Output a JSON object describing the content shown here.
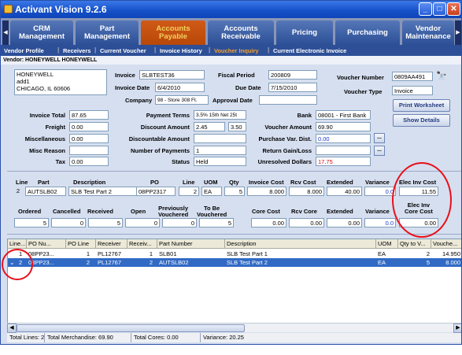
{
  "window": {
    "title": "Activant Vision 9.2.6"
  },
  "tabs": [
    {
      "label": "CRM\nManagement"
    },
    {
      "label": "Part\nManagement"
    },
    {
      "label": "Accounts\nPayable"
    },
    {
      "label": "Accounts\nReceivable"
    },
    {
      "label": "Pricing"
    },
    {
      "label": "Purchasing"
    },
    {
      "label": "Vendor\nMaintenance"
    }
  ],
  "subnav": [
    {
      "label": "Vendor Profile"
    },
    {
      "label": "Receivers"
    },
    {
      "label": "Current Voucher"
    },
    {
      "label": "Invoice History"
    },
    {
      "label": "Voucher Inquiry"
    },
    {
      "label": "Current Electronic Invoice"
    }
  ],
  "vendor_bar": "Vendor: HONEYWELL HONEYWELL",
  "address": [
    "HONEYWELL",
    "add1",
    "CHICAGO, IL 60606"
  ],
  "header": {
    "invoice_label": "Invoice",
    "invoice": "SLBTEST36",
    "invoice_date_label": "Invoice Date",
    "invoice_date": "6/4/2010",
    "company_label": "Company",
    "company": "98 - Store 308 Ft.",
    "fiscal_period_label": "Fiscal Period",
    "fiscal_period": "200809",
    "due_date_label": "Due Date",
    "due_date": "7/15/2010",
    "approval_date_label": "Approval Date",
    "approval_date": "",
    "voucher_number_label": "Voucher Number",
    "voucher_number": "0809AA491",
    "voucher_type_label": "Voucher Type",
    "voucher_type": "Invoice"
  },
  "buttons": {
    "print_worksheet": "Print Worksheet",
    "show_details": "Show Details",
    "ellipsis": "..."
  },
  "totals": {
    "invoice_total_label": "Invoice Total",
    "invoice_total": "87.65",
    "freight_label": "Freight",
    "freight": "0.00",
    "miscellaneous_label": "Miscellaneous",
    "miscellaneous": "0.00",
    "misc_reason_label": "Misc Reason",
    "misc_reason": "",
    "tax_label": "Tax",
    "tax": "0.00",
    "payment_terms_label": "Payment Terms",
    "payment_terms": "3.5% 15th Net 25t",
    "discount_amount_label": "Discount Amount",
    "discount_amount": "2.45",
    "discount_pct": "3.50",
    "discountable_amount_label": "Discountable Amount",
    "discountable_amount": "",
    "num_payments_label": "Number of Payments",
    "num_payments": "1",
    "status_label": "Status",
    "status": "Held",
    "bank_label": "Bank",
    "bank": "08001 - First Bank",
    "voucher_amount_label": "Voucher Amount",
    "voucher_amount": "69.90",
    "purchase_var_label": "Purchase Var. Dist.",
    "purchase_var": "0.00",
    "return_gain_label": "Return Gain/Loss",
    "return_gain": "",
    "unresolved_label": "Unresolved Dollars",
    "unresolved": "17.75"
  },
  "line_detail": {
    "headers": [
      "Line",
      "Part",
      "Description",
      "PO",
      "Line",
      "UOM",
      "Qty",
      "Invoice Cost",
      "Rcv Cost",
      "Extended",
      "Variance",
      "Elec Inv Cost"
    ],
    "values": [
      "2",
      "AUTSLB02",
      "SLB Test Part 2",
      "08PP2317",
      "2",
      "EA",
      "5",
      "8.000",
      "8.000",
      "40.00",
      "0.0",
      "11.55"
    ],
    "headers2": [
      "Ordered",
      "Cancelled",
      "Received",
      "Open",
      "Previously\nVouchered",
      "To Be\nVouchered",
      "Core Cost",
      "Rcv Core",
      "Extended",
      "Variance",
      "Elec Inv\nCore Cost"
    ],
    "values2": [
      "5",
      "0",
      "5",
      "0",
      "0",
      "5",
      "0.00",
      "0.00",
      "0.00",
      "0.0",
      "0.00"
    ]
  },
  "grid": {
    "columns": [
      "Line...",
      "PO Nu...",
      "PO Line",
      "Receiver",
      "Receiv...",
      "Part Number",
      "Description",
      "UOM",
      "Qty to V...",
      "Vouche..."
    ],
    "rows": [
      [
        "1",
        "08PP23...",
        "1",
        "PL12767",
        "1",
        "SLB01",
        "SLB Test Part 1",
        "EA",
        "2",
        "14.950"
      ],
      [
        "2",
        "08PP23...",
        "2",
        "PL12767",
        "2",
        "AUTSLB02",
        "SLB Test Part 2",
        "EA",
        "5",
        "8.000"
      ]
    ]
  },
  "status_bar": [
    "Total Lines: 2",
    "Total Merchandise: 69.90",
    "Total Cores: 0.00",
    "Variance: 20.25"
  ]
}
